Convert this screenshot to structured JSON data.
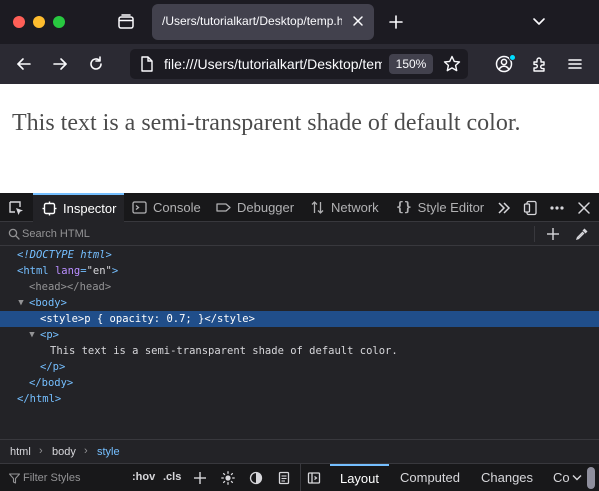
{
  "window": {
    "tab_title": "/Users/tutorialkart/Desktop/temp.html",
    "url": "file:///Users/tutorialkart/Desktop/temp.html",
    "zoom": "150%"
  },
  "page": {
    "paragraph": "This text is a semi-transparent shade of default color."
  },
  "devtools": {
    "tabs": [
      "Inspector",
      "Console",
      "Debugger",
      "Network",
      "Style Editor"
    ],
    "search_placeholder": "Search HTML",
    "tree": {
      "doctype": "<!DOCTYPE html>",
      "html_open": "<html",
      "lang_attr": "lang",
      "lang_val": "\"en\"",
      "html_close_bracket": ">",
      "head": "<head></head>",
      "body_open": "<body>",
      "style_open": "<style>",
      "style_content": "p { opacity: 0.7; }",
      "style_close": "</style>",
      "p_open": "<p>",
      "p_text": "This text is a semi-transparent shade of default color.",
      "p_close": "</p>",
      "body_close": "</body>",
      "html_close": "</html>"
    },
    "breadcrumbs": [
      "html",
      "body",
      "style"
    ],
    "rules": {
      "filter_placeholder": "Filter Styles",
      "hov": ":hov",
      "cls": ".cls"
    },
    "side_tabs": [
      "Layout",
      "Computed",
      "Changes",
      "Co"
    ]
  },
  "colors": {
    "accent": "#75bfff",
    "selection": "#204e8a",
    "tab_bg": "#42414d"
  }
}
